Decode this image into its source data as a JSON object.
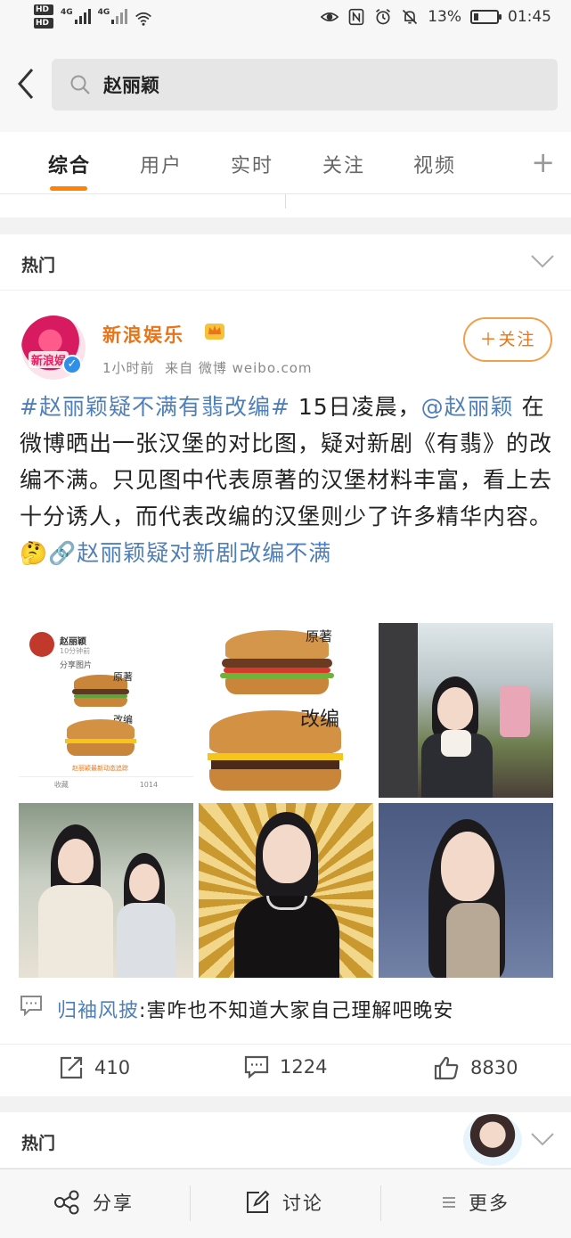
{
  "status_bar": {
    "hd1": "HD",
    "hd2": "HD",
    "sig1": "4G",
    "sig2": "4G",
    "battery": "13%",
    "time": "01:45"
  },
  "search": {
    "query": "赵丽颖"
  },
  "tabs": [
    {
      "label": "综合"
    },
    {
      "label": "用户"
    },
    {
      "label": "实时"
    },
    {
      "label": "关注"
    },
    {
      "label": "视频"
    }
  ],
  "hot_header": {
    "label": "热门"
  },
  "post": {
    "author": "新浪娱乐",
    "avatar_text": "新浪娱",
    "time": "1小时前",
    "source": "来自 微博 weibo.com",
    "follow_label": "＋关注",
    "text_hashtag": "#赵丽颖疑不满有翡改编#",
    "text_part1": " 15日凌晨，",
    "text_mention": "@赵丽颖",
    "text_part2": " 在微博晒出一张汉堡的对比图，疑对新剧《有翡》的改编不满。只见图中代表原著的汉堡材料丰富，看上去十分诱人，而代表改编的汉堡则少了许多精华内容。",
    "emoji": "🤔",
    "text_link": "🔗赵丽颖疑对新剧改编不满",
    "images": {
      "img1": {
        "name": "赵丽颖",
        "time": "10分钟前",
        "action": "分享图片",
        "label_top": "原著",
        "label_bottom": "改编",
        "link": "赵丽颖最新动态追踪",
        "fav": "收藏",
        "repost": "1014"
      },
      "img2": {
        "label_top": "原著",
        "label_bottom": "改编"
      }
    },
    "comment_user": "归袖风披",
    "comment_text": ":害咋也不知道大家自己理解吧晚安",
    "reposts": "410",
    "comments": "1224",
    "likes": "8830"
  },
  "hot_header2": {
    "label": "热门"
  },
  "bottom_bar": {
    "share": "分享",
    "discuss": "讨论",
    "more": "更多"
  },
  "colors": {
    "accent": "#ff8200",
    "author": "#e8751a",
    "link": "#4f7fb8",
    "verified": "#2e90e8"
  },
  "icons": [
    "back-arrow-icon",
    "search-icon",
    "plus-icon",
    "chevron-down-icon",
    "crown-icon",
    "verified-icon",
    "comment-icon",
    "repost-icon",
    "like-icon",
    "share-icon",
    "edit-icon",
    "menu-icon"
  ]
}
